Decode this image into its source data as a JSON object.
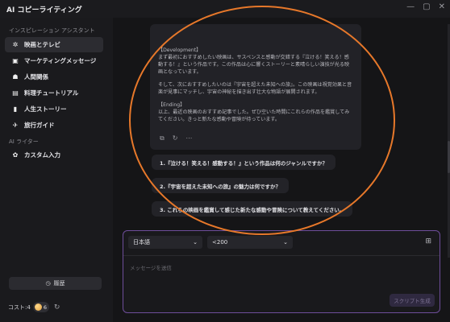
{
  "app": {
    "title": "AI コピーライティング"
  },
  "window_controls": {
    "minimize": "—",
    "maximize": "▢",
    "close": "✕"
  },
  "sidebar": {
    "section_assistant": "インスピレーション アシスタント",
    "items": [
      {
        "label": "映画とテレビ",
        "icon": "film-icon",
        "glyph": "✲",
        "active": true
      },
      {
        "label": "マーケティングメッセージ",
        "icon": "chart-icon",
        "glyph": "▣",
        "active": false
      },
      {
        "label": "人間関係",
        "icon": "people-icon",
        "glyph": "☗",
        "active": false
      },
      {
        "label": "料理チュートリアル",
        "icon": "cooking-icon",
        "glyph": "▤",
        "active": false
      },
      {
        "label": "人生ストーリー",
        "icon": "book-icon",
        "glyph": "▮",
        "active": false
      },
      {
        "label": "旅行ガイド",
        "icon": "airplane-icon",
        "glyph": "✈",
        "active": false
      }
    ],
    "section_writer": "AI ライター",
    "writer_items": [
      {
        "label": "カスタム入力",
        "icon": "gear-icon",
        "glyph": "✿"
      }
    ],
    "history_label": "履歴",
    "cost_label": "コスト:4",
    "coin_count": "6"
  },
  "chat": {
    "response_paragraphs": [
      "【Development】\n まず最初におすすめしたい映画は、サスペンスと感動が交錯する『泣ける！笑える！感動する！』という作品です。この作品は心に響くストーリーと素晴らしい演技が光る映画となっています。",
      "そして、次におすすめしたいのは『宇宙を超えた未知への旅』。この映画は視覚効果と音楽が見事にマッチし、宇宙の神秘を描き出す壮大な物語が展開されます。",
      "【Ending】\n 以上、最近の映画のおすすめ記事でした。ぜひ空いた時間にこれらの作品を鑑賞してみてください。きっと新たな感動や冒険が待っています。"
    ],
    "suggestions": [
      "1.『泣ける！笑える！感動する！』という作品は何のジャンルですか？",
      "2.『宇宙を超えた未知への旅』の魅力は何ですか？",
      "3. これらの映画を鑑賞して感じた新たな感動や冒険について教えてください。"
    ]
  },
  "composer": {
    "language": "日本語",
    "length": "<200",
    "placeholder": "メッセージを送信",
    "generate_label": "スクリプト生成"
  },
  "colors": {
    "accent_purple": "#6e4d9a",
    "annotation_orange": "#e7782a",
    "background": "#151517"
  }
}
